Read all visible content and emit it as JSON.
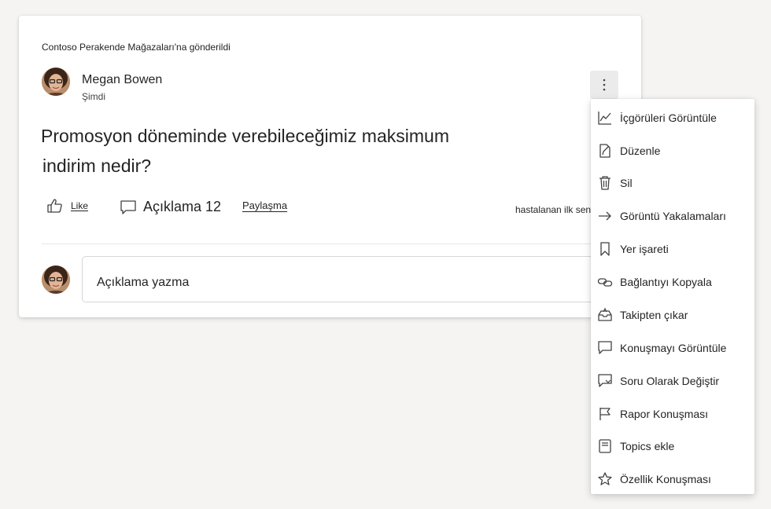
{
  "post": {
    "posted_to": "Contoso Perakende Mağazaları'na gönderildi",
    "author": "Megan Bowen",
    "timestamp": "Şimdi",
    "question_line1": "Promosyon döneminde verebileceğimiz maksimum",
    "question_line2": "indirim nedir?",
    "like_label": "Like",
    "comment_label": "Açıklama 12",
    "share_label": "Paylaşma",
    "first_reply": "hastalanan ilk sen olun",
    "comment_placeholder": "Açıklama yazma"
  },
  "menu": {
    "items": [
      {
        "label": "İçgörüleri Görüntüle",
        "icon": "chart-icon"
      },
      {
        "label": "Düzenle",
        "icon": "edit-icon"
      },
      {
        "label": "Sil",
        "icon": "trash-icon"
      },
      {
        "label": "Görüntü Yakalamaları",
        "icon": "share-arrow-icon"
      },
      {
        "label": "Yer işareti",
        "icon": "bookmark-icon"
      },
      {
        "label": "Bağlantıyı Kopyala",
        "icon": "link-icon"
      },
      {
        "label": "Takipten çıkar",
        "icon": "inbox-icon"
      },
      {
        "label": "Konuşmayı Görüntüle",
        "icon": "chat-icon"
      },
      {
        "label": "Soru Olarak Değiştir",
        "icon": "question-change-icon"
      },
      {
        "label": "Rapor Konuşması",
        "icon": "flag-icon"
      },
      {
        "label": "Topics ekle",
        "icon": "book-icon"
      },
      {
        "label": "Özellik Konuşması",
        "icon": "star-icon"
      }
    ]
  }
}
